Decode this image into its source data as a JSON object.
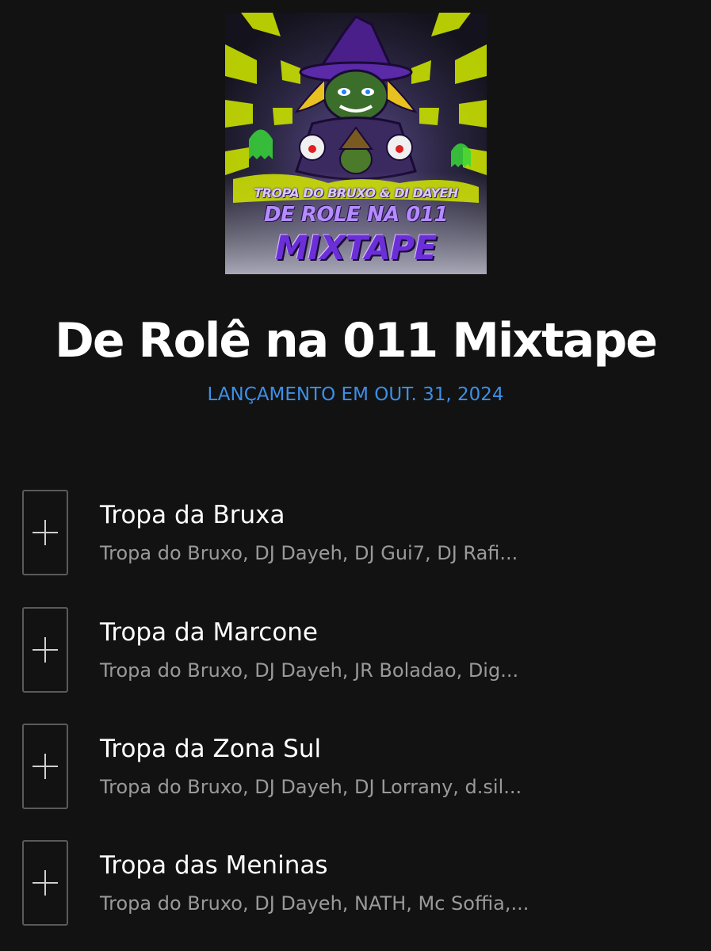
{
  "album": {
    "cover_art": {
      "line1": "TROPA DO BRUXO & DI DAYEH",
      "line2": "DE ROLE NA 011",
      "line3": "MIXTAPE"
    },
    "title": "De Rolê na 011 Mixtape",
    "release_date": "LANÇAMENTO EM OUT. 31, 2024"
  },
  "tracks": [
    {
      "name": "Tropa da Bruxa",
      "artists": "Tropa do Bruxo, DJ Dayeh, DJ Gui7, DJ Rafi...",
      "icon": "plus-icon"
    },
    {
      "name": "Tropa da Marcone",
      "artists": "Tropa do Bruxo, DJ Dayeh, JR Boladao, Dig...",
      "icon": "plus-icon"
    },
    {
      "name": "Tropa da Zona Sul",
      "artists": "Tropa do Bruxo, DJ Dayeh, DJ Lorrany, d.sil...",
      "icon": "plus-icon"
    },
    {
      "name": "Tropa das Meninas",
      "artists": "Tropa do Bruxo, DJ Dayeh, NATH, Mc Soffia,...",
      "icon": "plus-icon"
    }
  ],
  "colors": {
    "background": "#121212",
    "accent_date": "#3d8fe6",
    "secondary_text": "#9a9a9a"
  }
}
